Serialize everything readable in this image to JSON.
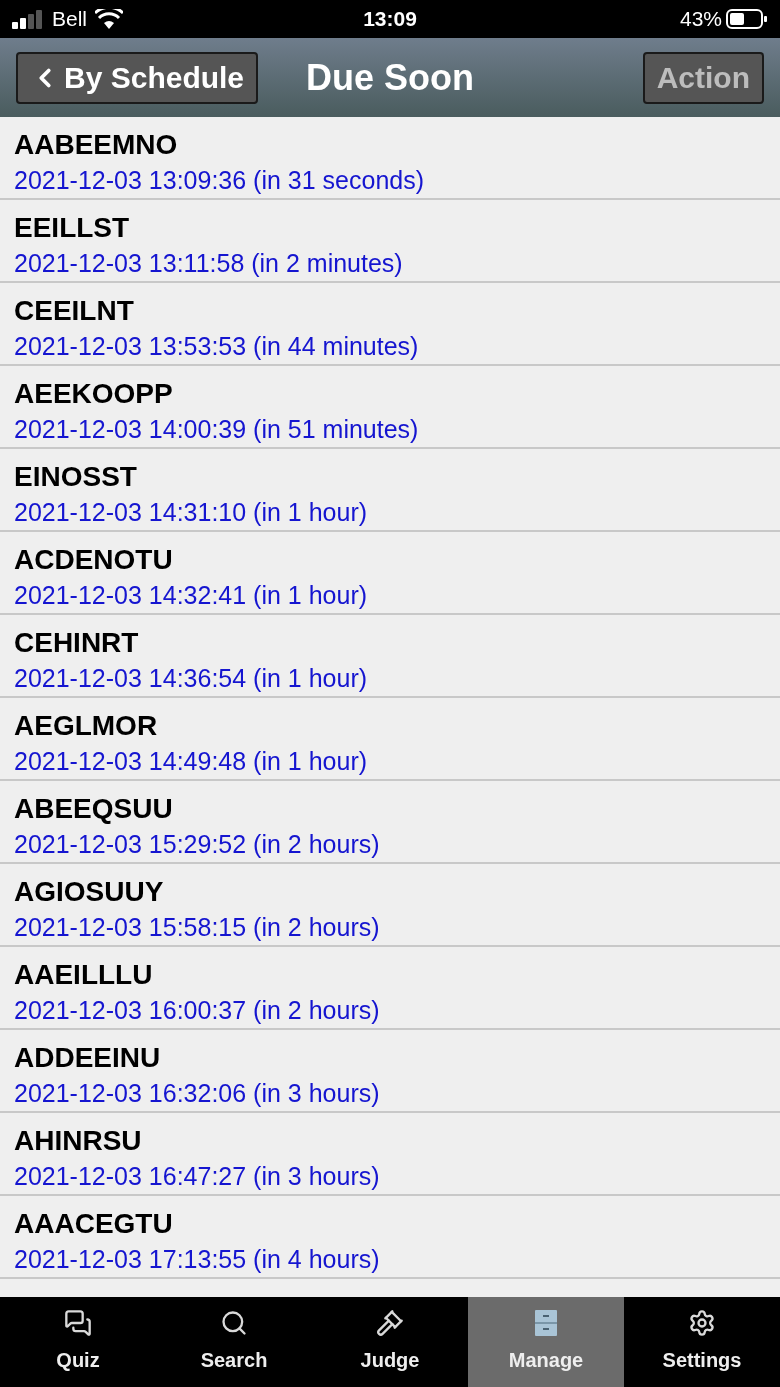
{
  "status_bar": {
    "carrier": "Bell",
    "time": "13:09",
    "battery": "43%"
  },
  "nav_bar": {
    "back_button": "By Schedule",
    "title": "Due Soon",
    "action_button": {
      "label": "Action",
      "disabled": true
    }
  },
  "items": [
    {
      "word": "AABEEMNO",
      "due": "2021-12-03 13:09:36 (in 31 seconds)"
    },
    {
      "word": "EEILLST",
      "due": "2021-12-03 13:11:58 (in 2 minutes)"
    },
    {
      "word": "CEEILNT",
      "due": "2021-12-03 13:53:53 (in 44 minutes)"
    },
    {
      "word": "AEEKOOPP",
      "due": "2021-12-03 14:00:39 (in 51 minutes)"
    },
    {
      "word": "EINOSST",
      "due": "2021-12-03 14:31:10 (in 1 hour)"
    },
    {
      "word": "ACDENOTU",
      "due": "2021-12-03 14:32:41 (in 1 hour)"
    },
    {
      "word": "CEHINRT",
      "due": "2021-12-03 14:36:54 (in 1 hour)"
    },
    {
      "word": "AEGLMOR",
      "due": "2021-12-03 14:49:48 (in 1 hour)"
    },
    {
      "word": "ABEEQSUU",
      "due": "2021-12-03 15:29:52 (in 2 hours)"
    },
    {
      "word": "AGIOSUUY",
      "due": "2021-12-03 15:58:15 (in 2 hours)"
    },
    {
      "word": "AAEILLLU",
      "due": "2021-12-03 16:00:37 (in 2 hours)"
    },
    {
      "word": "ADDEEINU",
      "due": "2021-12-03 16:32:06 (in 3 hours)"
    },
    {
      "word": "AHINRSU",
      "due": "2021-12-03 16:47:27 (in 3 hours)"
    },
    {
      "word": "AAACEGTU",
      "due": "2021-12-03 17:13:55 (in 4 hours)"
    }
  ],
  "tab_bar": [
    {
      "kind": "quiz",
      "label": "Quiz",
      "selected": false
    },
    {
      "kind": "search",
      "label": "Search",
      "selected": false
    },
    {
      "kind": "judge",
      "label": "Judge",
      "selected": false
    },
    {
      "kind": "manage",
      "label": "Manage",
      "selected": true
    },
    {
      "kind": "settings",
      "label": "Settings",
      "selected": false
    }
  ]
}
